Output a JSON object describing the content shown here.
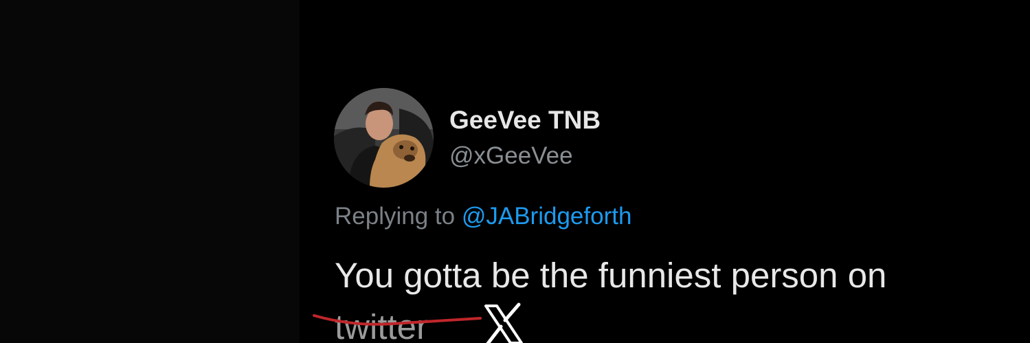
{
  "tweet": {
    "display_name": "GeeVee TNB",
    "handle": "@xGeeVee",
    "replying_to_prefix": "Replying to ",
    "replying_to_mention": "@JABridgeforth",
    "text_line1": "You gotta be the funniest person on",
    "struck_word": "twitter",
    "replacement_icon": "x-logo-icon"
  },
  "colors": {
    "background": "#000000",
    "name": "#e7e7e7",
    "secondary": "#8a8f94",
    "mention": "#1d9bf0",
    "strike": "#c0262a"
  }
}
